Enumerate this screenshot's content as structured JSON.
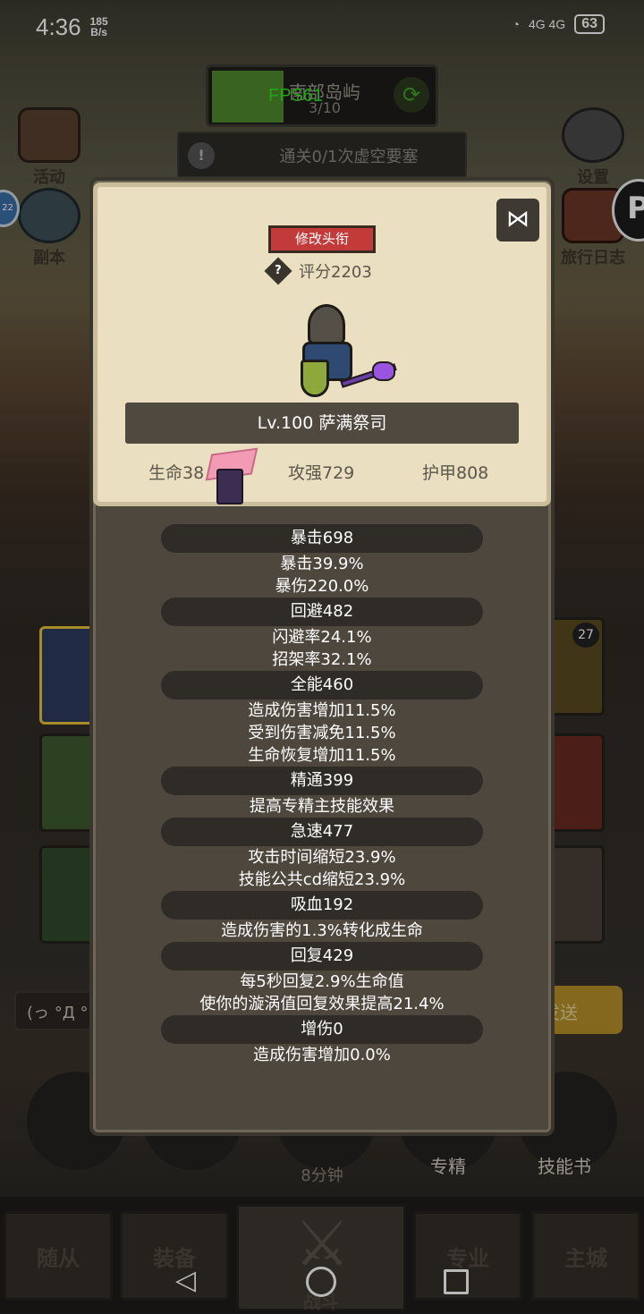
{
  "status": {
    "time": "4:36",
    "speed_value": "185",
    "speed_unit": "B/s",
    "network": "4G 4G",
    "battery": "63"
  },
  "top_banner": {
    "location": "南部岛屿",
    "progress": "3/10",
    "fps": "FPS61"
  },
  "quest": {
    "text": "通关0/1次虚空要塞"
  },
  "side_icons": {
    "activity": "活动",
    "dungeon": "副本",
    "settings": "设置",
    "journal": "旅行日志",
    "badge": "22"
  },
  "background": {
    "card_count": "27",
    "chat_text": "(っ °Д °",
    "send": "发送",
    "skill_timer": "8分钟",
    "skill_mastery": "专精",
    "skill_book": "技能书"
  },
  "bottom_nav": {
    "tab1": "随从",
    "tab2": "装备",
    "tab3": "战斗",
    "tab4": "专业",
    "tab5": "主城"
  },
  "panel": {
    "title_button": "修改头衔",
    "score": "评分2203",
    "name": "Lv.100 萨满祭司",
    "hp": "生命38",
    "attack": "攻强729",
    "armor": "护甲808"
  },
  "sections": [
    {
      "head": "暴击698",
      "lines": [
        "暴击39.9%",
        "暴伤220.0%"
      ]
    },
    {
      "head": "回避482",
      "lines": [
        "闪避率24.1%",
        "招架率32.1%"
      ]
    },
    {
      "head": "全能460",
      "lines": [
        "造成伤害增加11.5%",
        "受到伤害减免11.5%",
        "生命恢复增加11.5%"
      ]
    },
    {
      "head": "精通399",
      "lines": [
        "提高专精主技能效果"
      ]
    },
    {
      "head": "急速477",
      "lines": [
        "攻击时间缩短23.9%",
        "技能公共cd缩短23.9%"
      ]
    },
    {
      "head": "吸血192",
      "lines": [
        "造成伤害的1.3%转化成生命"
      ]
    },
    {
      "head": "回复429",
      "lines": [
        "每5秒回复2.9%生命值",
        "使你的漩涡值回复效果提高21.4%"
      ]
    },
    {
      "head": "增伤0",
      "lines": [
        "造成伤害增加0.0%"
      ]
    }
  ],
  "colors": {
    "title_button": "#c23b3a",
    "card_bg": "#eadfc0",
    "panel_bg": "#4d473d",
    "fps": "#2ee51d"
  },
  "icons": [
    "share-icon",
    "help-diamond-icon",
    "refresh-icon",
    "warning-icon",
    "gear-icon"
  ]
}
